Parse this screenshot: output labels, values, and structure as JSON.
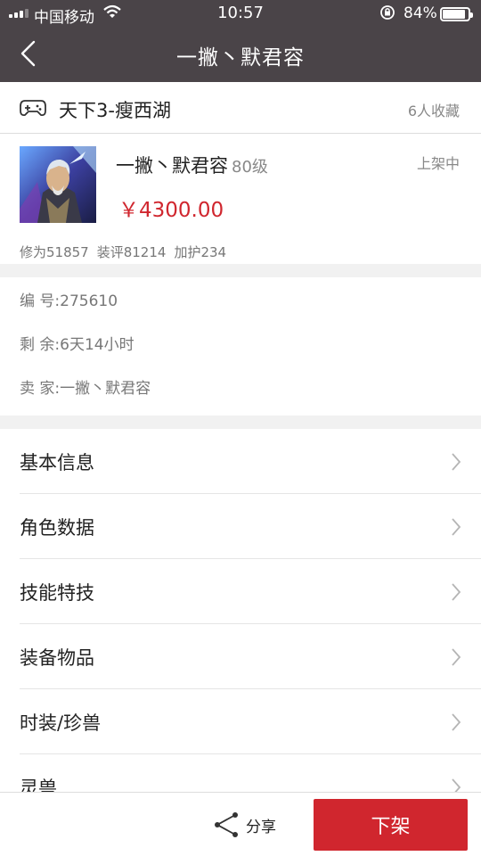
{
  "status_bar": {
    "carrier": "中国移动",
    "time": "10:57",
    "battery": "84%"
  },
  "nav": {
    "title": "一撇丶默君容"
  },
  "game": {
    "name": "天下3-瘦西湖",
    "favorites": "6人收藏"
  },
  "product": {
    "name": "一撇丶默君容",
    "level": "80级",
    "status": "上架中",
    "price": "￥4300.00",
    "stats": [
      "修为51857",
      "装评81214",
      "加护234"
    ]
  },
  "info": {
    "number": "编  号:275610",
    "remaining": "剩  余:6天14小时",
    "seller": "卖  家:一撇丶默君容"
  },
  "menu": {
    "items": [
      "基本信息",
      "角色数据",
      "技能特技",
      "装备物品",
      "时装/珍兽",
      "灵兽"
    ]
  },
  "bottom": {
    "share_label": "分享",
    "delist_label": "下架"
  },
  "colors": {
    "nav_bg": "#4a4448",
    "accent": "#d0262e"
  }
}
